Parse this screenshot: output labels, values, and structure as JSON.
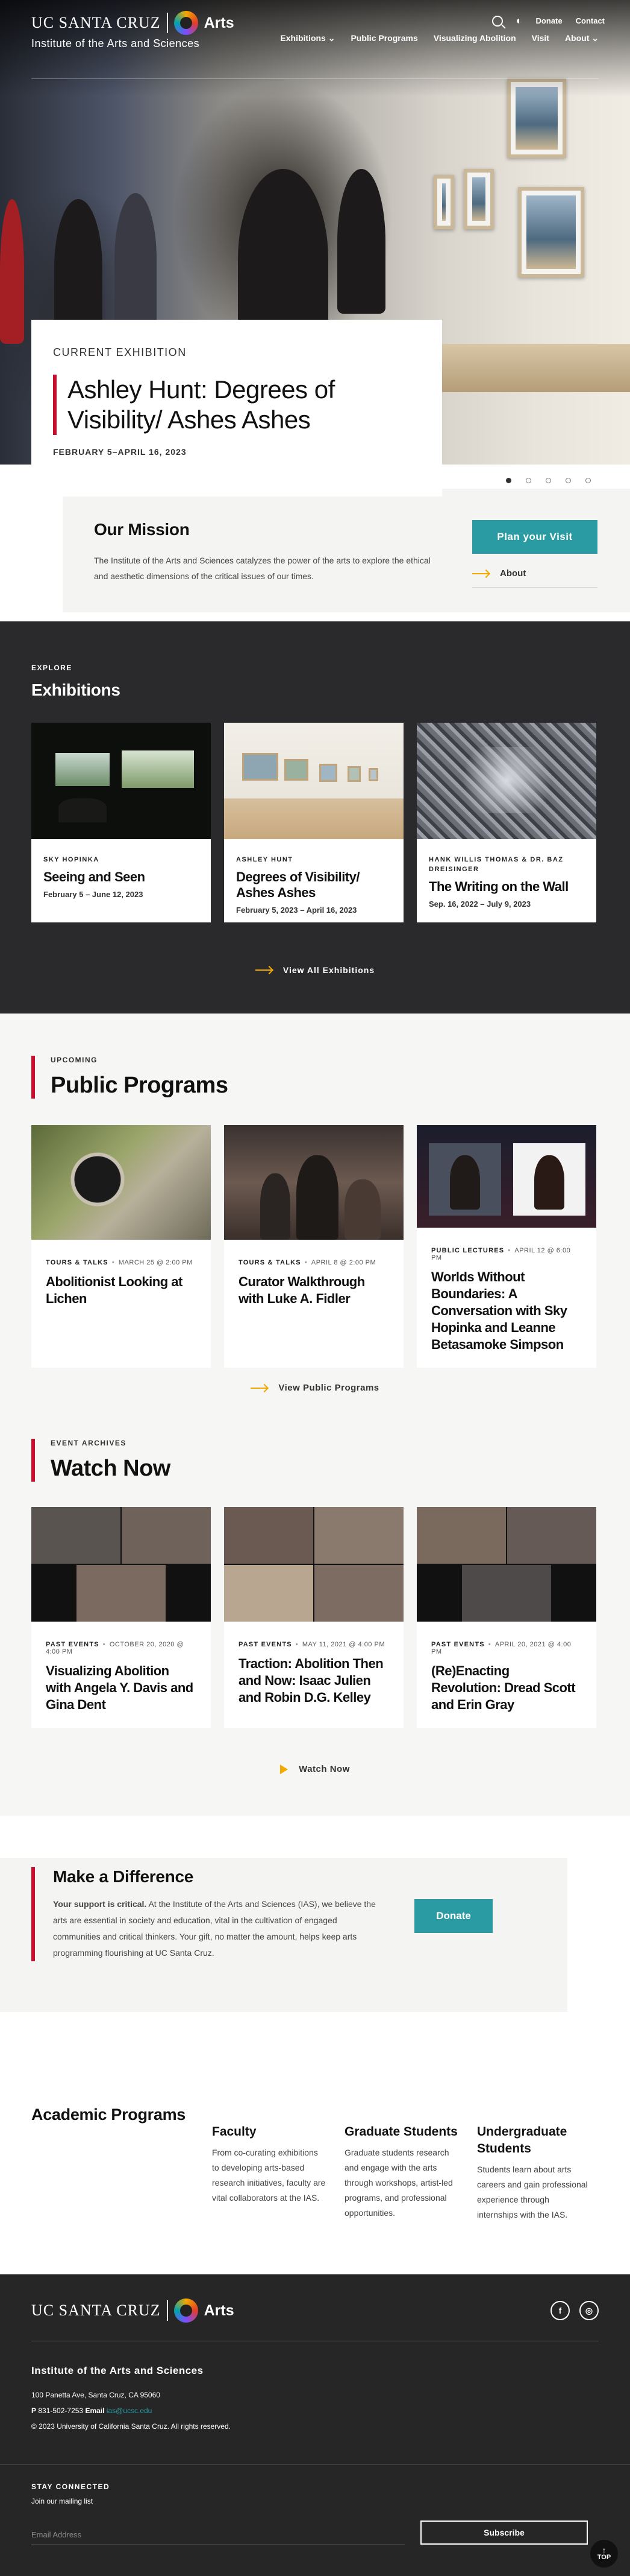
{
  "header": {
    "ucsc": "UC SANTA CRUZ",
    "arts": "Arts",
    "institute": "Institute of the Arts and Sciences",
    "utility": {
      "donate": "Donate",
      "contact": "Contact"
    },
    "nav": [
      "Exhibitions",
      "Public Programs",
      "Visualizing Abolition",
      "Visit",
      "About"
    ]
  },
  "hero": {
    "kicker": "CURRENT EXHIBITION",
    "title": "Ashley Hunt: Degrees of Visibility/ Ashes Ashes",
    "dates": "FEBRUARY 5–APRIL 16, 2023",
    "active_slide": 1,
    "slide_count": 5
  },
  "mission": {
    "title": "Our Mission",
    "text": "The Institute of the Arts and Sciences catalyzes the power of the arts to explore the ethical and aesthetic dimensions of the critical issues of our times.",
    "plan_button": "Plan your Visit",
    "about_link": "About"
  },
  "exhibitions": {
    "kicker": "EXPLORE",
    "title": "Exhibitions",
    "cards": [
      {
        "artist": "SKY HOPINKA",
        "title": "Seeing and Seen",
        "dates": "February 5 – June 12, 2023"
      },
      {
        "artist": "ASHLEY HUNT",
        "title": "Degrees of Visibility/ Ashes Ashes",
        "dates": "February 5, 2023 – April 16, 2023"
      },
      {
        "artist": "HANK WILLIS THOMAS & DR. BAZ DREISINGER",
        "title": "The Writing on the Wall",
        "dates": "Sep. 16, 2022 – July 9, 2023"
      }
    ],
    "view_all": "View All Exhibitions"
  },
  "programs": {
    "kicker": "UPCOMING",
    "title": "Public Programs",
    "cards": [
      {
        "type": "TOURS & TALKS",
        "date": "MARCH 25 @ 2:00 PM",
        "title": "Abolitionist Looking at Lichen"
      },
      {
        "type": "TOURS & TALKS",
        "date": "APRIL 8 @ 2:00 PM",
        "title": "Curator Walkthrough with Luke A. Fidler"
      },
      {
        "type": "PUBLIC LECTURES",
        "date": "APRIL 12 @ 6:00 PM",
        "title": "Worlds Without Boundaries: A Conversation with Sky Hopinka and Leanne Betasamoke Simpson"
      }
    ],
    "view_link": "View Public Programs"
  },
  "watch": {
    "kicker": "EVENT ARCHIVES",
    "title": "Watch Now",
    "cards": [
      {
        "type": "PAST EVENTS",
        "date": "OCTOBER 20, 2020 @ 4:00 PM",
        "title": "Visualizing Abolition with Angela Y. Davis and Gina Dent"
      },
      {
        "type": "PAST EVENTS",
        "date": "MAY 11, 2021 @ 4:00 PM",
        "title": "Traction: Abolition Then and Now: Isaac Julien and Robin D.G. Kelley"
      },
      {
        "type": "PAST EVENTS",
        "date": "APRIL 20, 2021 @ 4:00 PM",
        "title": "(Re)Enacting Revolution: Dread Scott and Erin Gray"
      }
    ],
    "watch_link": "Watch Now"
  },
  "donate": {
    "title": "Make a Difference",
    "lead": "Your support is critical.",
    "text": " At the Institute of the Arts and Sciences (IAS), we believe the arts are essential in society and education, vital in the cultivation of engaged communities and critical thinkers. Your gift, no matter the amount, helps keep arts programming flourishing at UC Santa Cruz.",
    "button": "Donate"
  },
  "academic": {
    "title": "Academic Programs",
    "columns": [
      {
        "title": "Faculty",
        "text": "From co-curating exhibitions to developing arts-based research initiatives, faculty are vital collaborators at the IAS."
      },
      {
        "title": "Graduate Students",
        "text": "Graduate students research and engage with the arts through workshops, artist-led programs, and professional opportunities."
      },
      {
        "title": "Undergraduate Students",
        "text": "Students learn about arts careers and gain professional experience through internships with the IAS."
      }
    ]
  },
  "footer": {
    "org": "Institute of the Arts and Sciences",
    "address": "100 Panetta Ave, Santa Cruz, CA 95060",
    "phone_label": "P",
    "phone": "831-502-7253",
    "email_label": "Email",
    "email": "ias@ucsc.edu",
    "copyright": "© 2023 University of California Santa Cruz. All rights reserved.",
    "stay_title": "STAY CONNECTED",
    "stay_text": "Join our mailing list",
    "email_placeholder": "Email Address",
    "subscribe": "Subscribe",
    "top": "TOP",
    "social": [
      "f",
      "◎"
    ]
  },
  "colors": {
    "accent_red": "#c8102e",
    "teal": "#2a9aa3",
    "gold": "#f2a900",
    "dark": "#2a2a2c"
  }
}
